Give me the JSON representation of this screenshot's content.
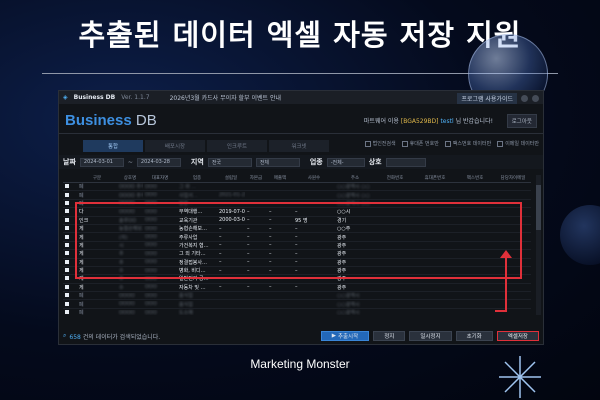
{
  "headline": "추출된 데이터 엑셀 자동 저장 지원",
  "footer_brand": "Marketing Monster",
  "app": {
    "titlebar": {
      "name": "Business DB",
      "version": "Ver. 1.1.7",
      "notice": "2026년3월 카드사 무이자 할부 이벤트 안내",
      "guide_button": "프로그램 사용가이드"
    },
    "brand_main": "Business",
    "brand_sub": " DB",
    "welcome_prefix": "마트웨어 이용",
    "welcome_name": "[BGA529BD]",
    "welcome_id": "testl",
    "welcome_suffix": "님 반갑습니다!",
    "logout": "로그아웃",
    "tabs": [
      "통합",
      "배포시장",
      "인크루트",
      "워크넷"
    ],
    "check_options": [
      "법인전검색",
      "휴대폰 번호만",
      "팩스번호 데이터만",
      "이메일 데이터만"
    ],
    "filter": {
      "date_label": "날짜",
      "date_from": "2024-03-01",
      "date_to": "2024-03-28",
      "region_label": "지역",
      "region_value": "전국",
      "region_sub": "전체",
      "industry_label": "업종",
      "industry_value": "-전체-",
      "name_label": "상호"
    },
    "grid": {
      "headers": [
        "구분",
        "상호명",
        "대표자명",
        "업종",
        "설립일",
        "자본금",
        "매출액",
        "사원수",
        "주소",
        "전화번호",
        "휴대폰번호",
        "팩스번호",
        "담당자이메일"
      ],
      "top_rows": [
        [
          "폐",
          "OOOO 주식회사",
          "OOO",
          "그 와 ...",
          "",
          "",
          "",
          "",
          "○○광역시 ○○",
          "",
          "",
          "",
          ""
        ],
        [
          "폐",
          "OOOO 주식회사",
          "OOO",
          "사업서...",
          "2021-01-21",
          "",
          "",
          "",
          "○○광역시 ○○",
          "",
          "",
          "",
          ""
        ],
        [
          "폐",
          "OOOO",
          "OOO",
          "방문...",
          "",
          "",
          "",
          "",
          "○○광역시 ○○",
          "",
          "",
          "",
          ""
        ]
      ],
      "highlighted_rows": [
        [
          "다",
          "OOOO",
          "OOO",
          "무역대행…",
          "2019-07-01",
          "–",
          "–",
          "–",
          "○○시",
          "",
          "",
          "",
          ""
        ],
        [
          "인크",
          "솔루OO",
          "OOO",
          "교육기관",
          "2000-03-01",
          "–",
          "–",
          "95 명",
          "경기",
          "",
          "",
          "",
          ""
        ],
        [
          "게",
          "농협손해보...",
          "OOO",
          "농협손해보…",
          "–",
          "–",
          "–",
          "–",
          "○○주",
          "",
          "",
          "",
          ""
        ],
        [
          "게",
          "(자)",
          "OOO",
          "주류사업",
          "–",
          "–",
          "–",
          "–",
          "광주",
          "",
          "",
          "",
          ""
        ],
        [
          "게",
          "시",
          "OOO",
          "가건복지 협…",
          "–",
          "–",
          "–",
          "–",
          "광주",
          "",
          "",
          "",
          ""
        ],
        [
          "게",
          "주",
          "OOO",
          "그 외 기타…",
          "–",
          "–",
          "–",
          "–",
          "광주",
          "",
          "",
          "",
          ""
        ],
        [
          "게",
          "주",
          "OOO",
          "정결접봉사…",
          "–",
          "–",
          "–",
          "–",
          "광주",
          "",
          "",
          "",
          ""
        ],
        [
          "게",
          "수",
          "OOO",
          "병화, 비디…",
          "–",
          "–",
          "–",
          "–",
          "광주",
          "",
          "",
          "",
          ""
        ],
        [
          "게",
          "주",
          "OOO",
          "일반전기 공…",
          "–",
          "–",
          "–",
          "–",
          "광주",
          "",
          "",
          "",
          ""
        ],
        [
          "게",
          "수",
          "OOO",
          "자동차 및 …",
          "–",
          "–",
          "–",
          "–",
          "광주",
          "",
          "",
          "",
          ""
        ]
      ],
      "bottom_rows": [
        [
          "폐",
          "OOOO",
          "OOO",
          "음식업",
          "",
          "",
          "",
          "",
          "○○광역시",
          "",
          "",
          "",
          ""
        ],
        [
          "폐",
          "OOOO",
          "OOO",
          "음식업",
          "",
          "",
          "",
          "",
          "○○광역시",
          "",
          "",
          "",
          ""
        ],
        [
          "폐",
          "OOOO",
          "OOO",
          "도소매",
          "",
          "",
          "",
          "",
          "○○광역시",
          "",
          "",
          "",
          ""
        ],
        [
          "폐",
          "OOOO",
          "OOO",
          "음식업",
          "",
          "",
          "",
          "",
          "○○광역시",
          "",
          "",
          "",
          ""
        ],
        [
          "폐",
          "OOOO",
          "OOO",
          "그 와 ...",
          "",
          "",
          "",
          "",
          "○○광역시",
          "",
          "",
          "",
          ""
        ],
        [
          "폐",
          "OOOO",
          "OOO",
          "광고대...",
          "",
          "",
          "",
          "",
          "○○광역시",
          "",
          "",
          "",
          ""
        ],
        [
          "폐",
          "OOOO",
          "OOO",
          "제조...",
          "",
          "",
          "",
          "",
          "○○광역시",
          "",
          "",
          "",
          ""
        ]
      ]
    },
    "status": {
      "count": "658",
      "count_suffix": " 건의 데이터가 검색되었습니다."
    },
    "buttons": {
      "start": "추출시작",
      "stop": "정지",
      "sms": "일시정지",
      "reset": "초기화",
      "excel": "엑셀저장"
    }
  }
}
